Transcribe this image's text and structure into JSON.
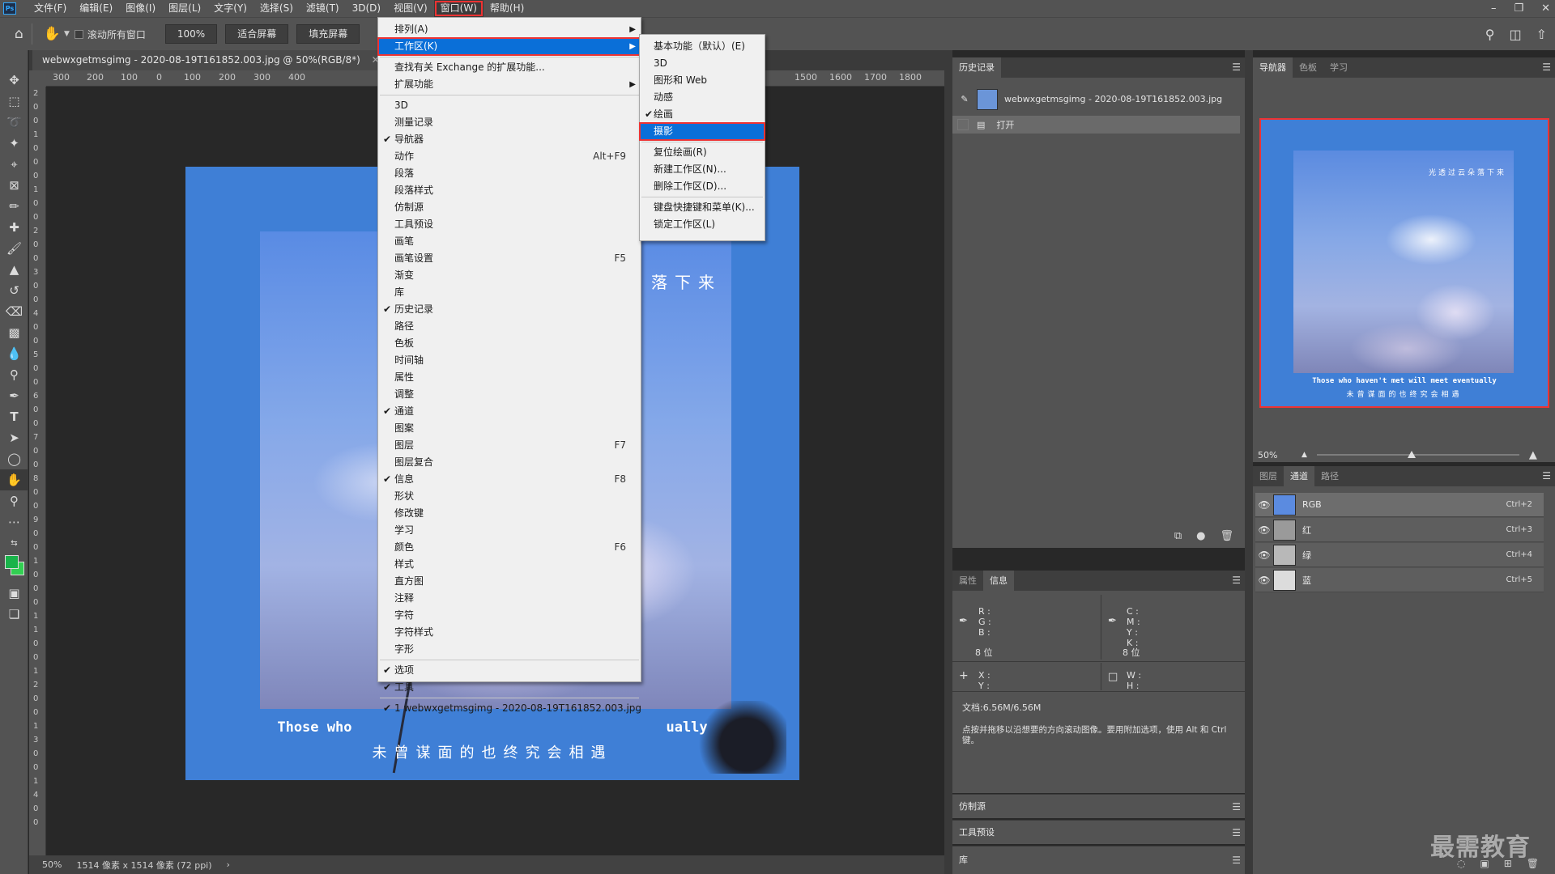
{
  "app": {
    "logo": "Ps"
  },
  "menubar": {
    "items": [
      "文件(F)",
      "编辑(E)",
      "图像(I)",
      "图层(L)",
      "文字(Y)",
      "选择(S)",
      "滤镜(T)",
      "3D(D)",
      "视图(V)",
      "窗口(W)",
      "帮助(H)"
    ],
    "active_item": "窗口(W)",
    "window_controls": [
      "minimize-icon",
      "restore-icon",
      "close-icon"
    ]
  },
  "options_bar": {
    "scroll_all_label": "滚动所有窗口",
    "zoom_value": "100%",
    "fit_screen_label": "适合屏幕",
    "fill_screen_label": "填充屏幕"
  },
  "document": {
    "tab_title": "webwxgetmsgimg - 2020-08-19T161852.003.jpg @ 50%(RGB/8*)",
    "ruler_h_labels": [
      "300",
      "200",
      "100",
      "0",
      "100",
      "200",
      "300",
      "400",
      "1500",
      "1600",
      "1700",
      "1800"
    ],
    "ruler_v_labels": [
      "2",
      "0",
      "0",
      "1",
      "0",
      "0",
      "0",
      "1",
      "0",
      "0",
      "2",
      "0",
      "0",
      "3",
      "0",
      "0",
      "4",
      "0",
      "0",
      "5",
      "0",
      "0",
      "6",
      "0",
      "0",
      "7",
      "0",
      "0",
      "8",
      "0",
      "0",
      "9",
      "0",
      "0",
      "1",
      "0",
      "0",
      "0",
      "1",
      "1",
      "0",
      "0",
      "1",
      "2",
      "0",
      "0",
      "1",
      "3",
      "0",
      "0",
      "1",
      "4",
      "0",
      "0"
    ],
    "artwork_title": "落下来",
    "artwork_en": "Those who haven't met will meet eventually",
    "artwork_en_partial_left": "Those who",
    "artwork_en_partial_right": "ually",
    "artwork_cn": "未曾谋面的也终究会相遇",
    "artwork_bg_color": "#3f7fd6"
  },
  "status_bar": {
    "zoom": "50%",
    "doc_info": "1514 像素 x 1514 像素 (72 ppi)"
  },
  "window_menu": {
    "items": [
      {
        "label": "排列(A)",
        "submenu": true
      },
      {
        "label": "工作区(K)",
        "submenu": true,
        "highlighted": true
      },
      {
        "sep": true
      },
      {
        "label": "查找有关 Exchange 的扩展功能..."
      },
      {
        "label": "扩展功能",
        "submenu": true
      },
      {
        "sep": true
      },
      {
        "label": "3D"
      },
      {
        "label": "测量记录"
      },
      {
        "label": "导航器",
        "checked": true
      },
      {
        "label": "动作",
        "shortcut": "Alt+F9"
      },
      {
        "label": "段落"
      },
      {
        "label": "段落样式"
      },
      {
        "label": "仿制源"
      },
      {
        "label": "工具预设"
      },
      {
        "label": "画笔"
      },
      {
        "label": "画笔设置",
        "shortcut": "F5"
      },
      {
        "label": "渐变"
      },
      {
        "label": "库"
      },
      {
        "label": "历史记录",
        "checked": true
      },
      {
        "label": "路径"
      },
      {
        "label": "色板"
      },
      {
        "label": "时间轴"
      },
      {
        "label": "属性"
      },
      {
        "label": "调整"
      },
      {
        "label": "通道",
        "checked": true
      },
      {
        "label": "图案"
      },
      {
        "label": "图层",
        "shortcut": "F7"
      },
      {
        "label": "图层复合"
      },
      {
        "label": "信息",
        "checked": true,
        "shortcut": "F8"
      },
      {
        "label": "形状"
      },
      {
        "label": "修改键"
      },
      {
        "label": "学习"
      },
      {
        "label": "颜色",
        "shortcut": "F6"
      },
      {
        "label": "样式"
      },
      {
        "label": "直方图"
      },
      {
        "label": "注释"
      },
      {
        "label": "字符"
      },
      {
        "label": "字符样式"
      },
      {
        "label": "字形"
      },
      {
        "sep": true
      },
      {
        "label": "选项",
        "checked": true
      },
      {
        "label": "工具",
        "checked": true
      },
      {
        "sep": true
      },
      {
        "label": "1 webwxgetmsgimg - 2020-08-19T161852.003.jpg",
        "checked": true
      }
    ]
  },
  "workspace_menu": {
    "items": [
      {
        "label": "基本功能（默认）(E)"
      },
      {
        "label": "3D"
      },
      {
        "label": "图形和 Web"
      },
      {
        "label": "动感"
      },
      {
        "label": "绘画",
        "checked": true
      },
      {
        "label": "摄影",
        "highlighted": true
      },
      {
        "sep": true
      },
      {
        "label": "复位绘画(R)"
      },
      {
        "label": "新建工作区(N)..."
      },
      {
        "label": "删除工作区(D)..."
      },
      {
        "sep": true
      },
      {
        "label": "键盘快捷键和菜单(K)..."
      },
      {
        "label": "锁定工作区(L)"
      }
    ]
  },
  "history_panel": {
    "tab": "历史记录",
    "snapshot_label": "webwxgetmsgimg - 2020-08-19T161852.003.jpg",
    "step_label": "打开"
  },
  "info_panel": {
    "tabs": [
      "属性",
      "信息"
    ],
    "active_tab": "信息",
    "rgb_labels": "R :\nG :\nB :",
    "cmyk_labels": "C :\nM :\nY :\nK :",
    "bits_left": "8 位",
    "bits_right": "8 位",
    "xy_labels": "X :\nY :",
    "wh_labels": "W :\nH :",
    "doc_size": "文档:6.56M/6.56M",
    "hint": "点按并拖移以沿想要的方向滚动图像。要用附加选项，使用 Alt 和 Ctrl 键。"
  },
  "collapsed_panels": [
    "仿制源",
    "工具预设",
    "库"
  ],
  "navigator_panel": {
    "tabs": [
      "导航器",
      "色板",
      "学习"
    ],
    "active_tab": "导航器",
    "zoom": "50%",
    "zoom_slider_fraction": 0.47,
    "preview_title": "光透过云朵落下来",
    "preview_en": "Those who haven't met will meet eventually",
    "preview_cn": "未曾谋面的也终究会相遇"
  },
  "channels_panel": {
    "tabs": [
      "图层",
      "通道",
      "路径"
    ],
    "active_tab": "通道",
    "channels": [
      {
        "name": "RGB",
        "shortcut": "Ctrl+2"
      },
      {
        "name": "红",
        "shortcut": "Ctrl+3"
      },
      {
        "name": "绿",
        "shortcut": "Ctrl+4"
      },
      {
        "name": "蓝",
        "shortcut": "Ctrl+5"
      }
    ]
  },
  "watermark": "最需教育",
  "colors": {
    "foreground": "#19b34a",
    "background": "#32d052",
    "accent": "#0a6fd8",
    "highlight_border": "#ee3333"
  }
}
